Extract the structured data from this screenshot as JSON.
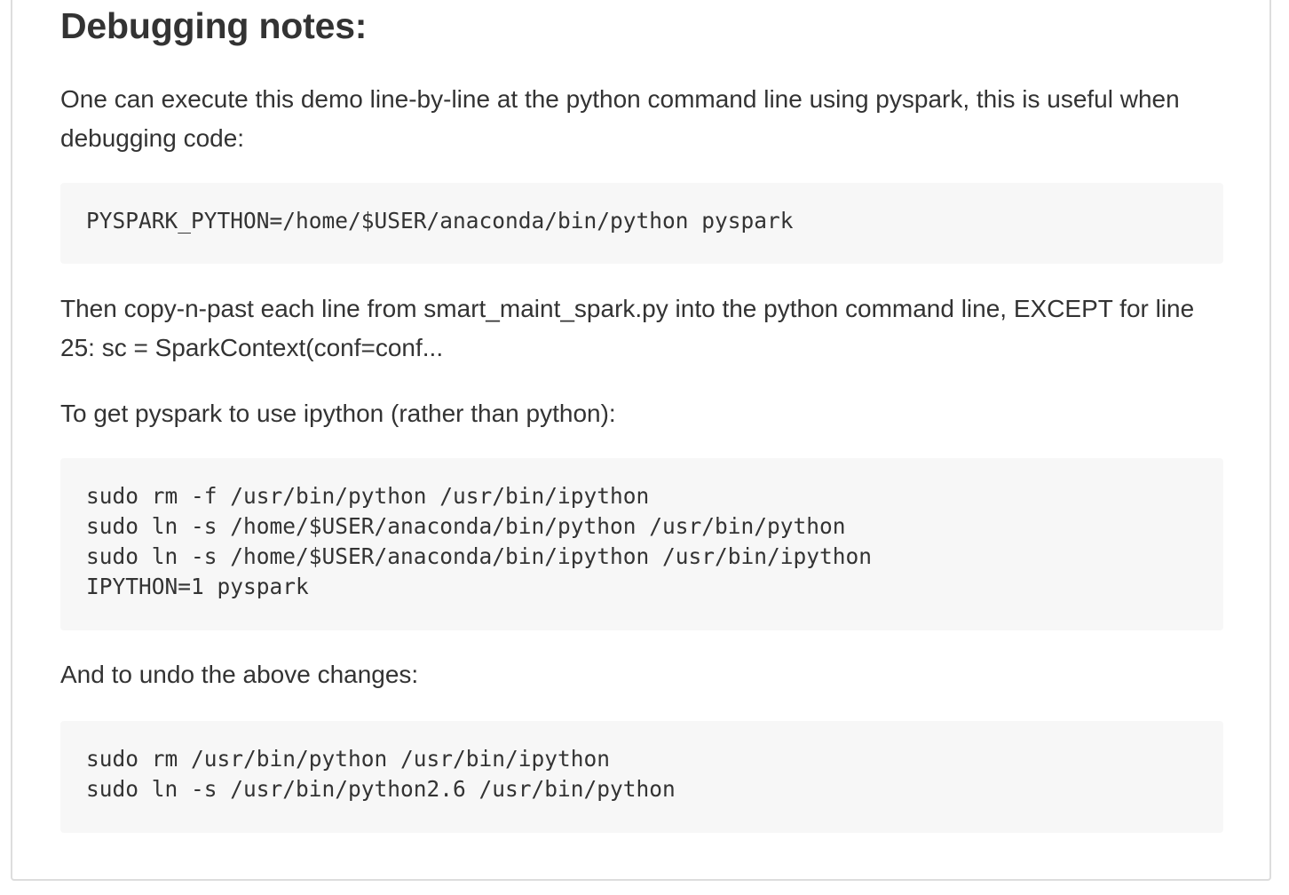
{
  "section": {
    "title": "Debugging notes:"
  },
  "paragraphs": {
    "intro": "One can execute this demo line-by-line at the python command line using pyspark, this is useful when debugging code:",
    "copy_paste": "Then copy-n-past each line from smart_maint_spark.py into the python command line, EXCEPT for line 25: sc = SparkContext(conf=conf...",
    "ipython": "To get pyspark to use ipython (rather than python):",
    "undo": "And to undo the above changes:"
  },
  "code_blocks": {
    "launch": [
      "PYSPARK_PYTHON=/home/$USER/anaconda/bin/python pyspark"
    ],
    "ipython_setup": [
      "sudo rm -f /usr/bin/python /usr/bin/ipython",
      "sudo ln -s /home/$USER/anaconda/bin/python /usr/bin/python",
      "sudo ln -s /home/$USER/anaconda/bin/ipython /usr/bin/ipython",
      "IPYTHON=1 pyspark"
    ],
    "undo": [
      "sudo rm /usr/bin/python /usr/bin/ipython",
      "sudo ln -s /usr/bin/python2.6 /usr/bin/python"
    ]
  },
  "colors": {
    "text": "#333333",
    "code_background": "#f7f7f7",
    "border": "#dddddd"
  }
}
